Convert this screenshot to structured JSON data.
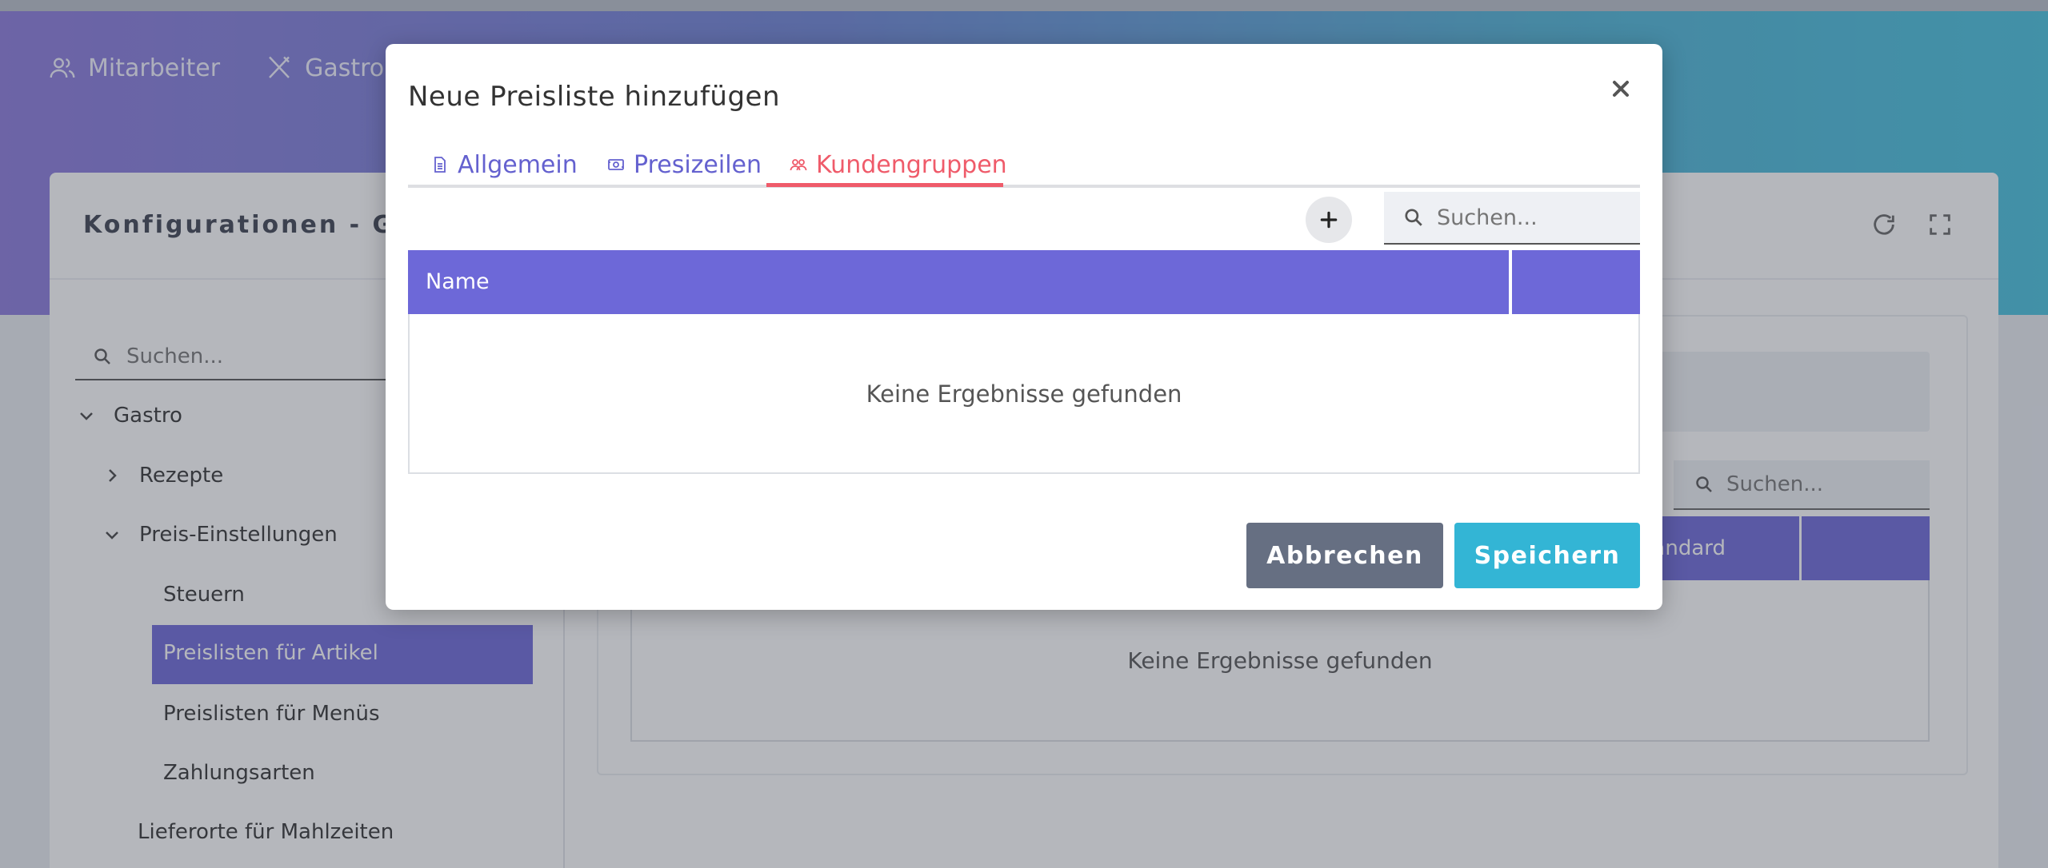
{
  "topnav": {
    "items": [
      {
        "label": "Mitarbeiter",
        "icon": "users-icon"
      },
      {
        "label": "Gastro",
        "icon": "utensils-icon"
      }
    ]
  },
  "card": {
    "title": "Konfigurationen - Gastr",
    "tools": [
      "refresh-icon",
      "fullscreen-icon"
    ]
  },
  "sidebar": {
    "search_placeholder": "Suchen...",
    "items": [
      {
        "label": "Gastro",
        "level": 0,
        "expanded": true
      },
      {
        "label": "Rezepte",
        "level": 1,
        "expanded": false
      },
      {
        "label": "Preis-Einstellungen",
        "level": 1,
        "expanded": true
      },
      {
        "label": "Steuern",
        "level": 2
      },
      {
        "label": "Preislisten für Artikel",
        "level": 2,
        "active": true
      },
      {
        "label": "Preislisten für Menüs",
        "level": 2
      },
      {
        "label": "Zahlungsarten",
        "level": 2
      },
      {
        "label": "Lieferorte für Mahlzeiten",
        "level": 1
      }
    ]
  },
  "right_panel": {
    "search_placeholder": "Suchen...",
    "column_standard": "andard",
    "empty_text": "Keine Ergebnisse gefunden"
  },
  "modal": {
    "title": "Neue Preisliste hinzufügen",
    "close_icon": "close-icon",
    "tabs": [
      {
        "label": "Allgemein",
        "icon": "document-icon",
        "active": false
      },
      {
        "label": "Presizeilen",
        "icon": "money-icon",
        "active": false
      },
      {
        "label": "Kundengruppen",
        "icon": "users-icon",
        "active": true
      }
    ],
    "search_placeholder": "Suchen...",
    "table": {
      "columns": [
        "Name",
        ""
      ],
      "empty_text": "Keine Ergebnisse gefunden"
    },
    "cancel_label": "Abbrechen",
    "save_label": "Speichern"
  },
  "colors": {
    "accent_purple": "#6d68d8",
    "tab_active_red": "#ef5b6a",
    "save_cyan": "#33b5d5",
    "cancel_gray": "#666f82"
  }
}
